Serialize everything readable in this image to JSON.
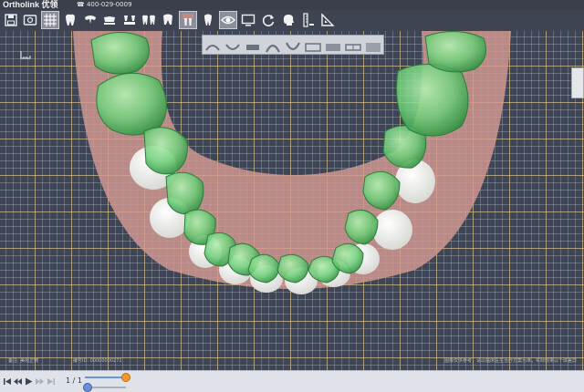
{
  "header": {
    "logo": "Ortholink 优领",
    "phone": "400-029-0009"
  },
  "toolbar": {
    "buttons": [
      {
        "name": "save-icon"
      },
      {
        "name": "screenshot-icon"
      },
      {
        "name": "grid-icon",
        "active": true
      },
      {
        "name": "tooth-view-icon"
      },
      {
        "name": "upper-jaw-icon"
      },
      {
        "name": "lower-jaw-icon"
      },
      {
        "name": "bracket-icon"
      },
      {
        "name": "teeth-icon"
      },
      {
        "name": "gum-tooth-icon",
        "active": true
      },
      {
        "name": "single-tooth-icon"
      },
      {
        "name": "visibility-eye-icon",
        "active": true
      },
      {
        "name": "monitor-icon"
      },
      {
        "name": "refresh-icon"
      },
      {
        "name": "head-profile-icon"
      },
      {
        "name": "ruler-icon"
      },
      {
        "name": "triangle-ruler-icon"
      }
    ]
  },
  "view_strip": {
    "items": [
      "upper-occlusal-view",
      "lower-occlusal-view",
      "front-view",
      "upper-arch-view",
      "lower-arch-view",
      "left-view",
      "right-view",
      "back-view",
      "full-view"
    ]
  },
  "footer": {
    "left_note": "备注: 美观正畸",
    "mid_note": "编号ID: 00000000271",
    "right_note": "图像仅供参考，请以临床医生治疗方案为准，实际效果以个体差异"
  },
  "playback": {
    "frame_count": "1 / 1",
    "frame_progress": 1.0,
    "speed_progress": 0.0
  },
  "colors": {
    "tooth_green": "#6fd07a",
    "tooth_white": "#f2f2ef",
    "gum_pink": "#d49a92",
    "grid_major": "#e1c478",
    "accent_orange": "#f29b28"
  }
}
